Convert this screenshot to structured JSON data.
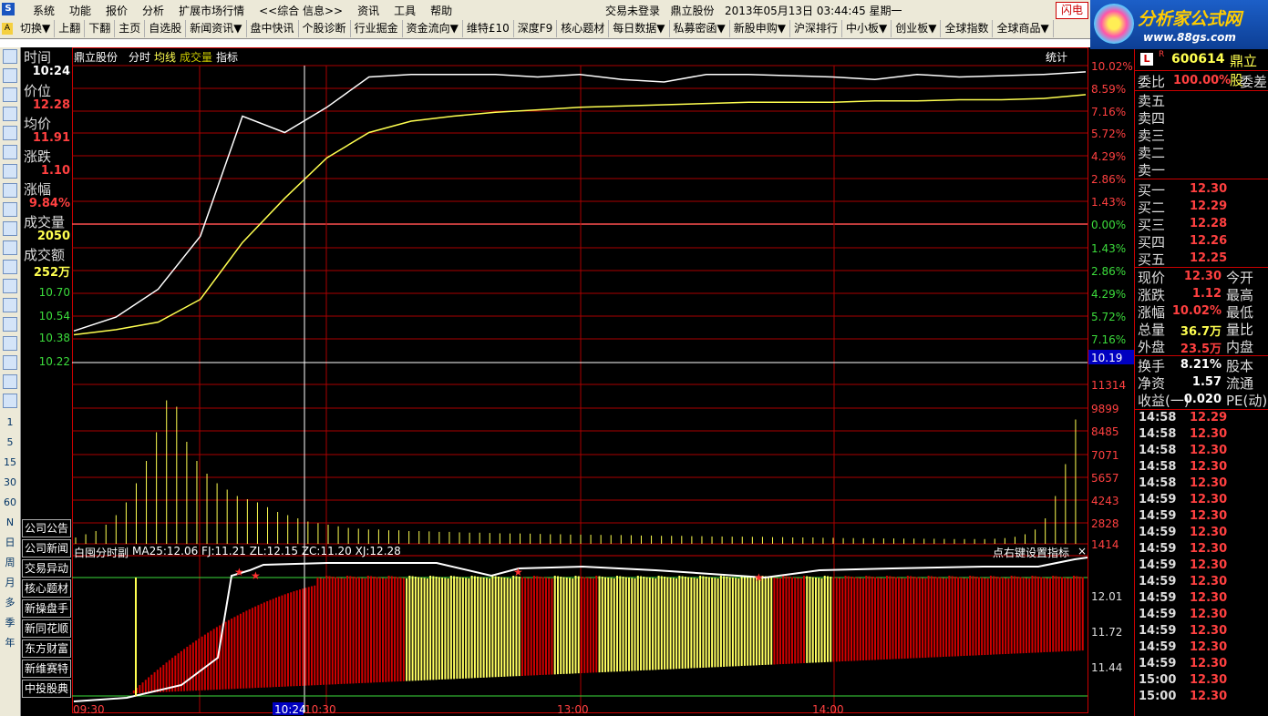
{
  "menu": {
    "items": [
      "系统",
      "功能",
      "报价",
      "分析",
      "扩展市场行情",
      "<<综合 信息>>",
      "资讯",
      "工具",
      "帮助"
    ],
    "status": "交易未登录",
    "stock": "鼎立股份",
    "datetime": "2013年05月13日 03:44:45 星期一",
    "flash": "闪电"
  },
  "brand": {
    "name": "分析家公式网",
    "url": "www.88gs.com"
  },
  "toolbar": {
    "items": [
      "切换▼",
      "上翻",
      "下翻",
      "主页",
      "自选股",
      "新闻资讯▼",
      "盘中快讯",
      "个股诊断",
      "行业掘金",
      "资金流向▼",
      "维特£10",
      "深度F9",
      "核心题材",
      "每日数据▼",
      "私募密函▼",
      "新股申购▼",
      "沪深排行",
      "中小板▼",
      "创业板▼",
      "全球指数",
      "全球商品▼"
    ]
  },
  "sidebar": {
    "icons": [
      "chart-icon",
      "grid-icon",
      "line-icon",
      "candle-icon",
      "table-icon",
      "f10-icon",
      "doc-icon",
      "news-icon",
      "f2-icon",
      "f6-icon",
      "search-icon",
      "rise-icon",
      "wave-icon",
      "pulse-icon",
      "ten-icon",
      "plus-icon",
      "pen-icon",
      "f5-icon",
      "refresh-icon"
    ],
    "periods": [
      "1",
      "5",
      "15",
      "30",
      "60",
      "N",
      "日",
      "周",
      "月",
      "多",
      "季",
      "年"
    ]
  },
  "info": {
    "time_label": "时间",
    "time_value": "10:24",
    "price_label": "价位",
    "price_value": "12.28",
    "avg_label": "均价",
    "avg_value": "11.91",
    "change_label": "涨跌",
    "change_value": "1.10",
    "pct_label": "涨幅",
    "pct_value": "9.84%",
    "vol_label": "成交量",
    "vol_value": "2050",
    "amt_label": "成交额",
    "amt_value": "252万",
    "lower_prices": [
      "10.70",
      "10.54",
      "10.38",
      "10.22"
    ]
  },
  "left_buttons": [
    "公司公告",
    "公司新闻",
    "交易异动",
    "核心题材",
    "新操盘手",
    "新同花顺",
    "东方财富",
    "新维赛特",
    "中投股典"
  ],
  "chart_header": {
    "name": "鼎立股份",
    "items": [
      "分时",
      "均线",
      "成交量",
      "指标"
    ],
    "stats": "统计"
  },
  "chart_data": [
    {
      "type": "line",
      "title": "鼎立股份",
      "series": [
        {
          "name": "分时",
          "values": [
            10.25,
            10.36,
            10.58,
            11.0,
            11.95,
            11.82,
            12.02,
            12.26,
            12.28,
            12.28,
            12.28,
            12.26,
            12.28,
            12.24,
            12.22,
            12.28,
            12.28,
            12.27,
            12.26,
            12.24,
            12.28,
            12.26,
            12.27,
            12.28,
            12.3
          ]
        },
        {
          "name": "均线",
          "values": [
            10.22,
            10.26,
            10.32,
            10.5,
            10.95,
            11.3,
            11.62,
            11.82,
            11.91,
            11.95,
            11.98,
            12.0,
            12.02,
            12.03,
            12.04,
            12.05,
            12.06,
            12.06,
            12.06,
            12.07,
            12.07,
            12.08,
            12.08,
            12.09,
            12.12
          ]
        }
      ],
      "yticks_right_pct": [
        "10.02%",
        "8.59%",
        "7.16%",
        "5.72%",
        "4.29%",
        "2.86%",
        "1.43%",
        "0.00%",
        "1.43%",
        "2.86%",
        "4.29%",
        "5.72%",
        "7.16%"
      ],
      "crosshair_value": "10.19"
    },
    {
      "type": "bar",
      "title": "成交量",
      "values": [
        40,
        60,
        80,
        120,
        180,
        260,
        380,
        520,
        700,
        900,
        860,
        640,
        520,
        440,
        380,
        340,
        300,
        280,
        260,
        230,
        200,
        180,
        160,
        140,
        130,
        120,
        110,
        100,
        95,
        90,
        90,
        85,
        85,
        80,
        80,
        78,
        75,
        75,
        72,
        70,
        70,
        68,
        66,
        65,
        65,
        64,
        62,
        60,
        60,
        58,
        58,
        57,
        56,
        55,
        55,
        54,
        52,
        52,
        50,
        50,
        50,
        48,
        48,
        46,
        46,
        45,
        45,
        44,
        44,
        42,
        42,
        40,
        40,
        40,
        38,
        38,
        36,
        36,
        35,
        35,
        34,
        34,
        33,
        33,
        32,
        32,
        31,
        30,
        30,
        30,
        30,
        32,
        36,
        44,
        60,
        90,
        160,
        300,
        500,
        780
      ],
      "yticks": [
        "11314",
        "9899",
        "8485",
        "7071",
        "5657",
        "4243",
        "2828",
        "1414"
      ]
    },
    {
      "type": "bar",
      "title": "白囤分时副",
      "legend": "MA25:12.06  FJ:11.21  ZL:12.15  ZC:11.20  XJ:12.28",
      "yticks": [
        "12.01",
        "11.72",
        "11.44"
      ]
    }
  ],
  "sub_header": {
    "settings": "点右键设置指标",
    "close": "×"
  },
  "xaxis": {
    "labels": [
      "09:30",
      "10:24",
      "10:30",
      "13:00",
      "14:00"
    ]
  },
  "quote": {
    "code": "600614",
    "name": "鼎立股",
    "ratio_label": "委比",
    "ratio_value": "100.00%",
    "diff_label": "委差",
    "sells": [
      "卖五",
      "卖四",
      "卖三",
      "卖二",
      "卖一"
    ],
    "buys": [
      {
        "label": "买一",
        "price": "12.30"
      },
      {
        "label": "买二",
        "price": "12.29"
      },
      {
        "label": "买三",
        "price": "12.28"
      },
      {
        "label": "买四",
        "price": "12.26"
      },
      {
        "label": "买五",
        "price": "12.25"
      }
    ],
    "stats": [
      {
        "l1": "现价",
        "v": "12.30",
        "l2": "今开",
        "c": "red"
      },
      {
        "l1": "涨跌",
        "v": "1.12",
        "l2": "最高",
        "c": "red"
      },
      {
        "l1": "涨幅",
        "v": "10.02%",
        "l2": "最低",
        "c": "red"
      },
      {
        "l1": "总量",
        "v": "36.7万",
        "l2": "量比",
        "c": "yellow"
      },
      {
        "l1": "外盘",
        "v": "23.5万",
        "l2": "内盘",
        "c": "red"
      }
    ],
    "extra": [
      {
        "l1": "换手",
        "v": "8.21%",
        "l2": "股本"
      },
      {
        "l1": "净资",
        "v": "1.57",
        "l2": "流通"
      },
      {
        "l1": "收益(一)",
        "v": "0.020",
        "l2": "PE(动)"
      }
    ],
    "ticks": [
      {
        "t": "14:58",
        "p": "12.29"
      },
      {
        "t": "14:58",
        "p": "12.30"
      },
      {
        "t": "14:58",
        "p": "12.30"
      },
      {
        "t": "14:58",
        "p": "12.30"
      },
      {
        "t": "14:58",
        "p": "12.30"
      },
      {
        "t": "14:59",
        "p": "12.30"
      },
      {
        "t": "14:59",
        "p": "12.30"
      },
      {
        "t": "14:59",
        "p": "12.30"
      },
      {
        "t": "14:59",
        "p": "12.30"
      },
      {
        "t": "14:59",
        "p": "12.30"
      },
      {
        "t": "14:59",
        "p": "12.30"
      },
      {
        "t": "14:59",
        "p": "12.30"
      },
      {
        "t": "14:59",
        "p": "12.30"
      },
      {
        "t": "14:59",
        "p": "12.30"
      },
      {
        "t": "14:59",
        "p": "12.30"
      },
      {
        "t": "14:59",
        "p": "12.30"
      },
      {
        "t": "15:00",
        "p": "12.30"
      },
      {
        "t": "15:00",
        "p": "12.30"
      }
    ]
  }
}
